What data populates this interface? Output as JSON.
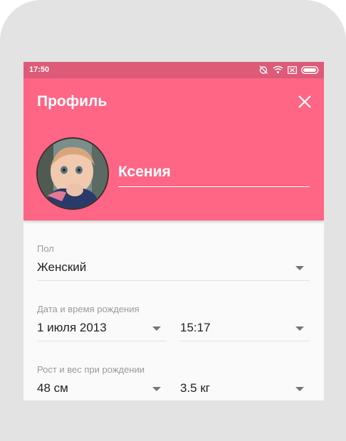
{
  "status_bar": {
    "time": "17:50"
  },
  "header": {
    "title": "Профиль",
    "name_value": "Ксения"
  },
  "form": {
    "gender": {
      "label": "Пол",
      "value": "Женский"
    },
    "birth": {
      "label": "Дата и время рождения",
      "date": "1 июля 2013",
      "time": "15:17"
    },
    "measures": {
      "label": "Рост и вес при рождении",
      "height": "48 см",
      "weight": "3.5 кг"
    }
  },
  "colors": {
    "accent": "#ff6585",
    "status_bar": "#dd5a78",
    "frame": "#e3e3e3"
  },
  "icons": [
    "alarm-off-icon",
    "wifi-icon",
    "sim-icon",
    "battery-icon",
    "close-icon",
    "caret-down-icon"
  ]
}
